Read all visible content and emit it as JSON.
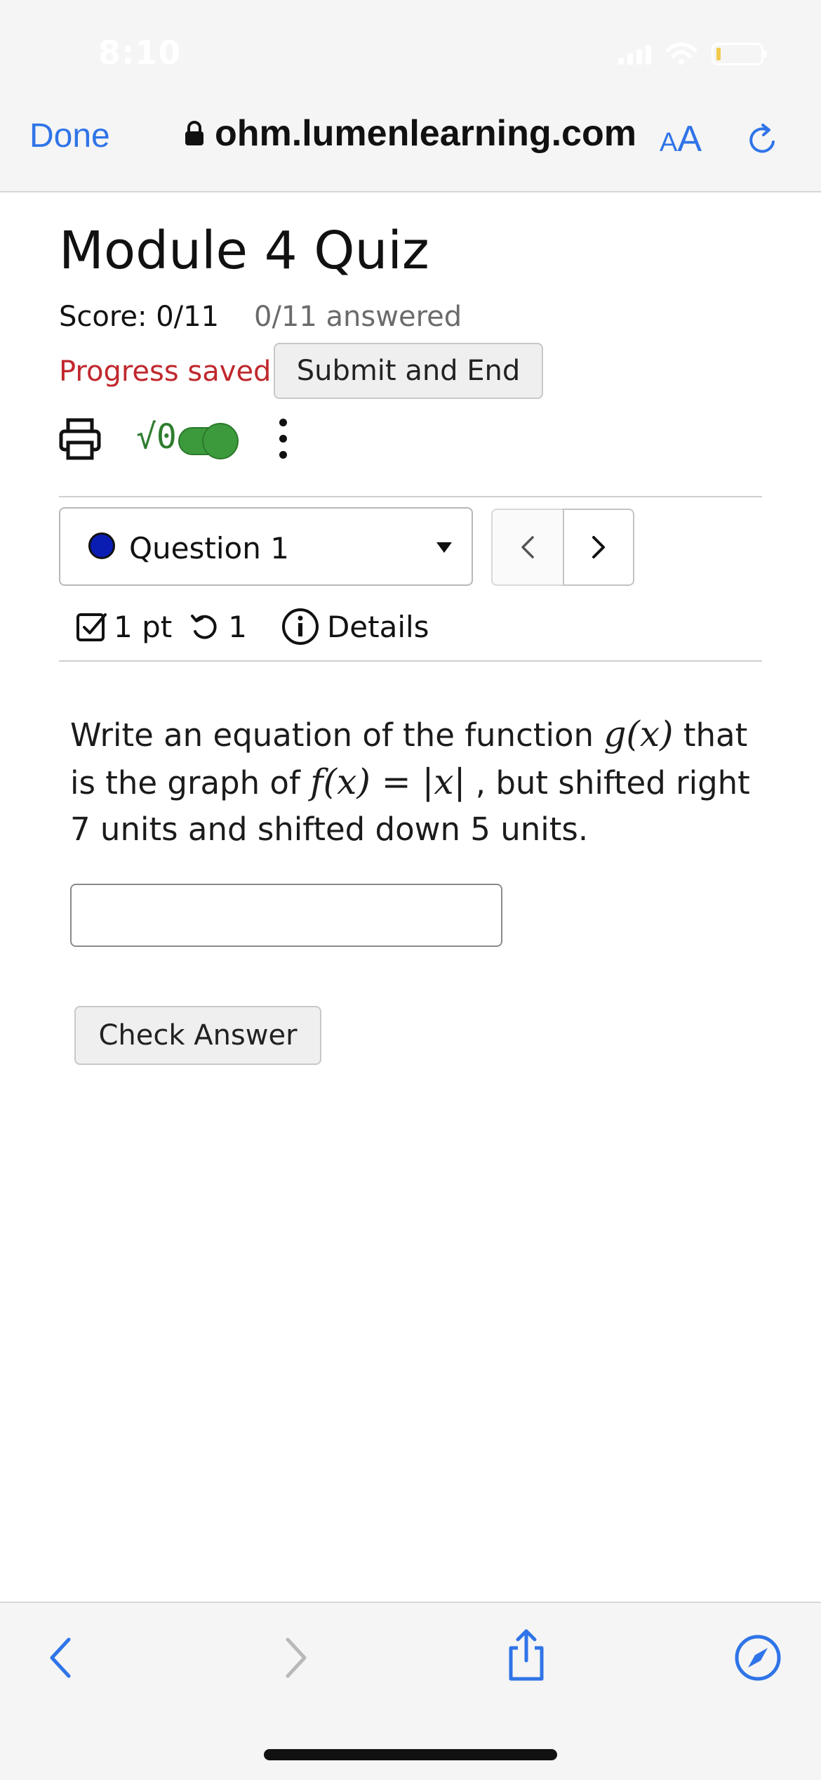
{
  "status_bar": {
    "time": "8:10"
  },
  "browser": {
    "done_label": "Done",
    "url": "ohm.lumenlearning.com",
    "text_size_small": "A",
    "text_size_big": "A"
  },
  "quiz": {
    "title": "Module 4 Quiz",
    "score": "Score: 0/11",
    "answered": "0/11 answered",
    "progress": "Progress saved",
    "submit_label": "Submit and End",
    "sqrt_label": "√0"
  },
  "question_nav": {
    "selected": "Question 1",
    "prev": "<",
    "next": ">"
  },
  "question_meta": {
    "points": "1 pt",
    "attempts": "1",
    "details": "Details"
  },
  "question": {
    "text_1": "Write an equation of the function ",
    "math_g": "g(x)",
    "text_2": " that is the graph of ",
    "math_f": "f(x) = |x|",
    "text_3": " , but shifted right 7 units and shifted down 5 units."
  },
  "answer": {
    "value": "",
    "check_label": "Check Answer"
  },
  "colors": {
    "link_blue": "#2f74e8",
    "saved_red": "#c0282d",
    "toggle_green": "#3c9a3c",
    "question_dot": "#0a1db3"
  }
}
